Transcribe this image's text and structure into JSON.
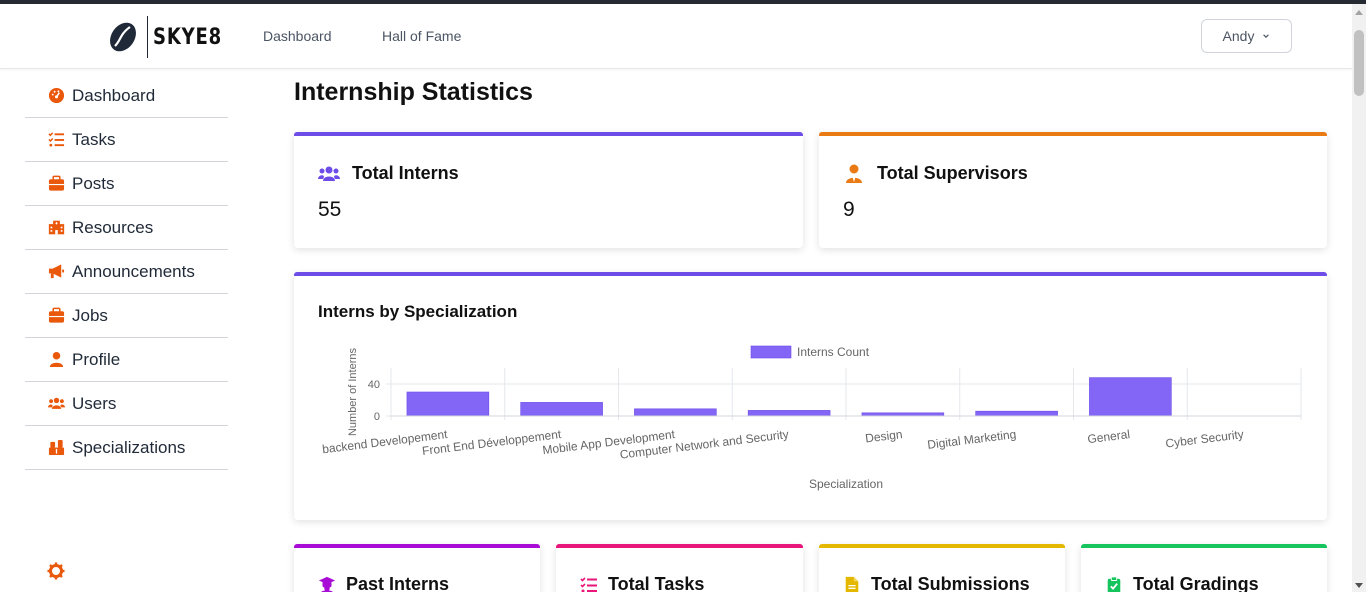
{
  "header": {
    "brand": "SKYE8",
    "nav": [
      "Dashboard",
      "Hall of Fame"
    ],
    "user": "Andy"
  },
  "sidebar": {
    "items": [
      {
        "label": "Dashboard",
        "icon": "gauge-icon"
      },
      {
        "label": "Tasks",
        "icon": "tasks-list-icon"
      },
      {
        "label": "Posts",
        "icon": "briefcase-icon"
      },
      {
        "label": "Resources",
        "icon": "building-icon"
      },
      {
        "label": "Announcements",
        "icon": "megaphone-icon"
      },
      {
        "label": "Jobs",
        "icon": "briefcase-icon"
      },
      {
        "label": "Profile",
        "icon": "user-icon"
      },
      {
        "label": "Users",
        "icon": "users-icon"
      },
      {
        "label": "Specializations",
        "icon": "blocks-icon"
      }
    ],
    "icon_color": "#ea580c"
  },
  "main": {
    "title": "Internship Statistics",
    "stats": [
      {
        "label": "Total Interns",
        "value": "55",
        "icon": "users-icon",
        "color": "#6d4ce8"
      },
      {
        "label": "Total Supervisors",
        "value": "9",
        "icon": "user-tie-icon",
        "color": "#ea7a14"
      }
    ],
    "chart_card": {
      "title": "Interns by Specialization",
      "color": "#6d4ce8"
    },
    "bottom_cards": [
      {
        "label": "Past Interns",
        "icon": "graduate-icon",
        "color": "#a80bd6"
      },
      {
        "label": "Total Tasks",
        "icon": "tasks-list-icon",
        "color": "#e8157a"
      },
      {
        "label": "Total Submissions",
        "icon": "file-icon",
        "color": "#e5b800"
      },
      {
        "label": "Total Gradings",
        "icon": "clipboard-check-icon",
        "color": "#16c45e"
      }
    ]
  },
  "chart_data": {
    "type": "bar",
    "categories": [
      "backend Developement",
      "Front End Développement",
      "Mobile App Development",
      "Computer Network and Security",
      "Design",
      "Digital Marketing",
      "General",
      "Cyber Security"
    ],
    "series": [
      {
        "name": "Interns Count",
        "values": [
          30,
          17,
          9,
          7,
          4,
          6,
          48,
          0
        ]
      }
    ],
    "xlabel": "Specialization",
    "ylabel": "Number of Interns",
    "yticks": [
      "0",
      "40"
    ],
    "ylim": [
      0,
      50
    ],
    "legend": "top-center",
    "bar_color": "#8466f7",
    "grid": true
  }
}
